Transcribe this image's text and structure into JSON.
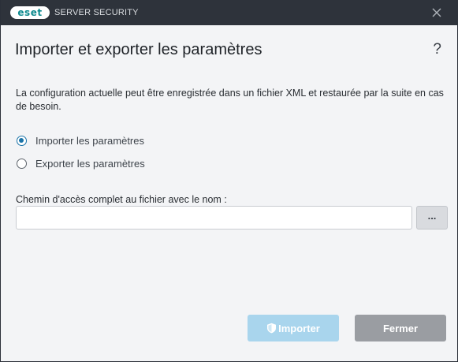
{
  "titlebar": {
    "logo_text": "eset",
    "product_name": "SERVER SECURITY"
  },
  "dialog": {
    "title": "Importer et exporter les paramètres",
    "help": "?",
    "description": "La configuration actuelle peut être enregistrée dans un fichier XML et restaurée par la suite en cas de besoin.",
    "options": [
      {
        "label": "Importer les paramètres",
        "selected": true
      },
      {
        "label": "Exporter les paramètres",
        "selected": false
      }
    ],
    "path_label": "Chemin d'accès complet au fichier avec le nom :",
    "path_value": "",
    "browse_label": "...",
    "import_label": "Importer",
    "close_label": "Fermer"
  },
  "colors": {
    "titlebar_bg": "#2e333b",
    "accent": "#1a73a8",
    "import_button_disabled": "#a9d5ed",
    "close_button": "#9a9da2"
  },
  "icons": [
    "close-icon",
    "help-icon",
    "shield-icon"
  ]
}
